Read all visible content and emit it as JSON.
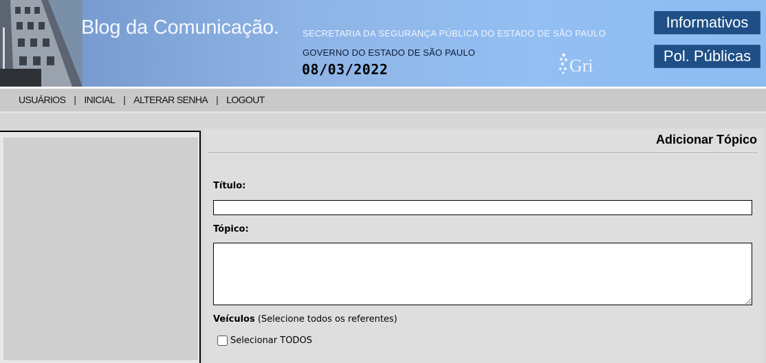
{
  "header": {
    "site_title": "Blog da Comunicação.",
    "secretaria": "SECRETARIA DA SEGURANÇA PÚBLICA DO ESTADO DE SÃO PAULO",
    "governo": "GOVERNO DO ESTADO DE SÃO PAULO",
    "date": "08/03/2022",
    "gri_logo_text": "Gri",
    "buttons": {
      "informativos": "Informativos",
      "politicas": "Pol. Públicas"
    }
  },
  "menu": {
    "items": [
      "USUÁRIOS",
      "INICIAL",
      "ALTERAR SENHA",
      "LOGOUT"
    ],
    "separator": "|"
  },
  "form": {
    "heading": "Adicionar Tópico",
    "titulo_label": "Título:",
    "titulo_value": "",
    "topico_label": "Tópico:",
    "topico_value": "",
    "veiculos_label": "Veículos",
    "veiculos_hint": " (Selecione todos os referentes)",
    "select_all_label": "Selecionar TODOS",
    "select_all_checked": false
  },
  "colors": {
    "banner": "#8fb4e6",
    "button_bg": "#1f4f86",
    "menubar": "#c9c9c9",
    "panel": "#dedede"
  }
}
